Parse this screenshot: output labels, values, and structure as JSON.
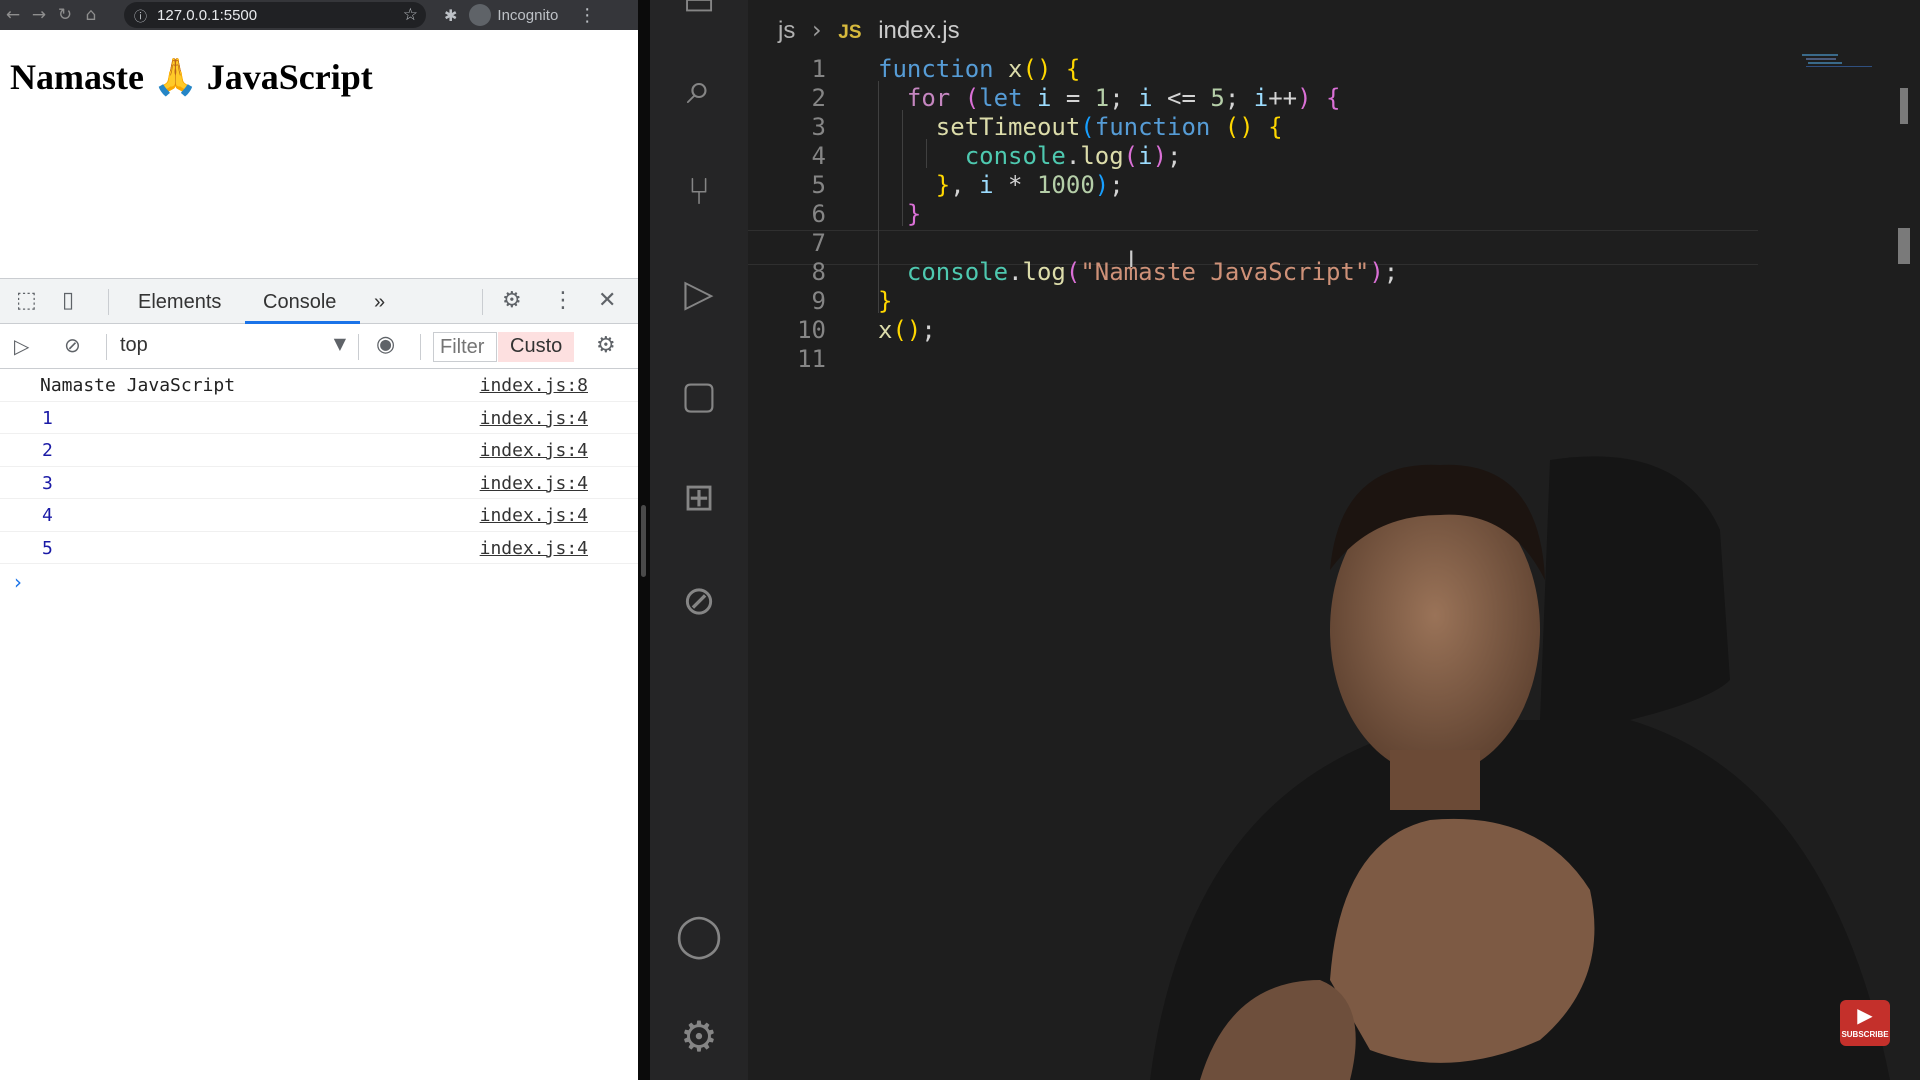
{
  "browser": {
    "url": "127.0.0.1:5500",
    "profile_label": "Incognito",
    "page_heading": "Namaste 🙏 JavaScript"
  },
  "devtools": {
    "tabs": [
      "Elements",
      "Console"
    ],
    "active_tab": "Console",
    "more_tabs_glyph": "»",
    "context": "top",
    "filter_placeholder": "Filter",
    "levels_label": "Custo",
    "console_output": [
      {
        "message": "Namaste JavaScript",
        "source": "index.js:8",
        "kind": "string"
      },
      {
        "message": "1",
        "source": "index.js:4",
        "kind": "number"
      },
      {
        "message": "2",
        "source": "index.js:4",
        "kind": "number"
      },
      {
        "message": "3",
        "source": "index.js:4",
        "kind": "number"
      },
      {
        "message": "4",
        "source": "index.js:4",
        "kind": "number"
      },
      {
        "message": "5",
        "source": "index.js:4",
        "kind": "number"
      }
    ],
    "prompt_glyph": "›"
  },
  "editor": {
    "breadcrumb": {
      "folder": "js",
      "badge": "JS",
      "file": "index.js"
    },
    "line_numbers": [
      "1",
      "2",
      "3",
      "4",
      "5",
      "6",
      "7",
      "8",
      "9",
      "10",
      "11"
    ],
    "code_lines": [
      "function x() {",
      "  for (let i = 1; i <= 5; i++) {",
      "    setTimeout(function () {",
      "      console.log(i);",
      "    }, i * 1000);",
      "  }",
      "",
      "  console.log(\"Namaste JavaScript\");",
      "}",
      "x();",
      ""
    ],
    "language": "javascript"
  },
  "overlay": {
    "subscribe_label": "SUBSCRIBE"
  },
  "colors": {
    "editor_bg": "#1e1e1e",
    "keyword": "#569cd6",
    "control": "#c586c0",
    "function": "#dcdcaa",
    "string": "#ce9178",
    "accent": "#1a73e8"
  }
}
